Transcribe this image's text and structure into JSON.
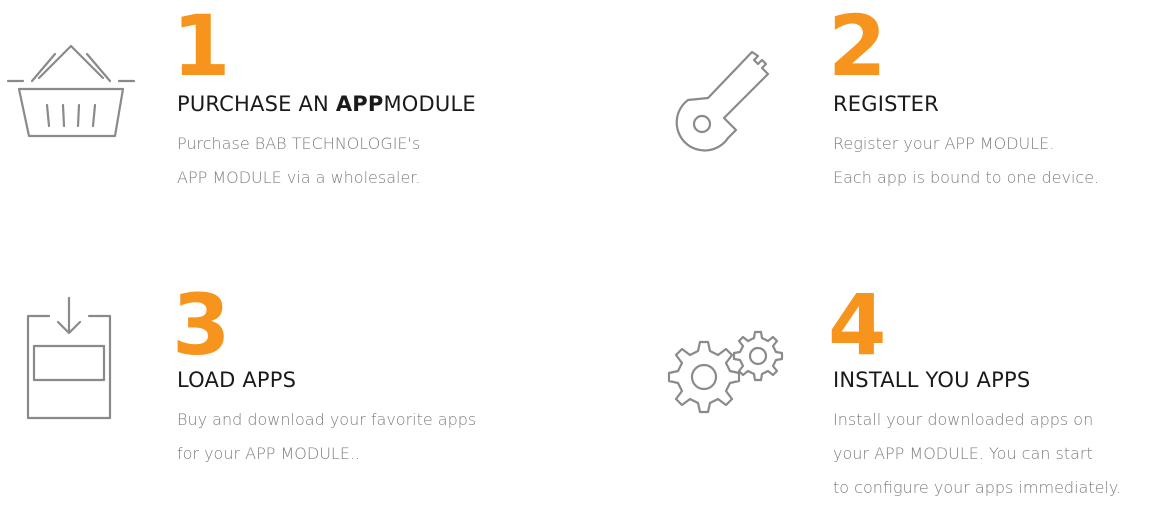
{
  "accent_color": "#f7941d",
  "icon_color": "#8a8a8a",
  "steps": [
    {
      "number": "1",
      "title_pre": "PURCHASE AN ",
      "title_bold": "APP",
      "title_post": "MODULE",
      "desc": [
        "Purchase BAB TECHNOLOGIE's",
        "APP MODULE via a wholesaler."
      ],
      "icon": "basket-icon"
    },
    {
      "number": "2",
      "title": "REGISTER",
      "desc": [
        "Register your  APP MODULE.",
        "Each app is bound to one device."
      ],
      "icon": "key-icon"
    },
    {
      "number": "3",
      "title": "LOAD APPS",
      "desc": [
        "Buy and download your favorite apps",
        "for your APP MODULE.."
      ],
      "icon": "download-icon"
    },
    {
      "number": "4",
      "title": "INSTALL YOU APPS",
      "desc": [
        "Install your downloaded apps on",
        "your APP MODULE. You can start",
        "to configure your apps immediately."
      ],
      "icon": "gears-icon"
    }
  ]
}
